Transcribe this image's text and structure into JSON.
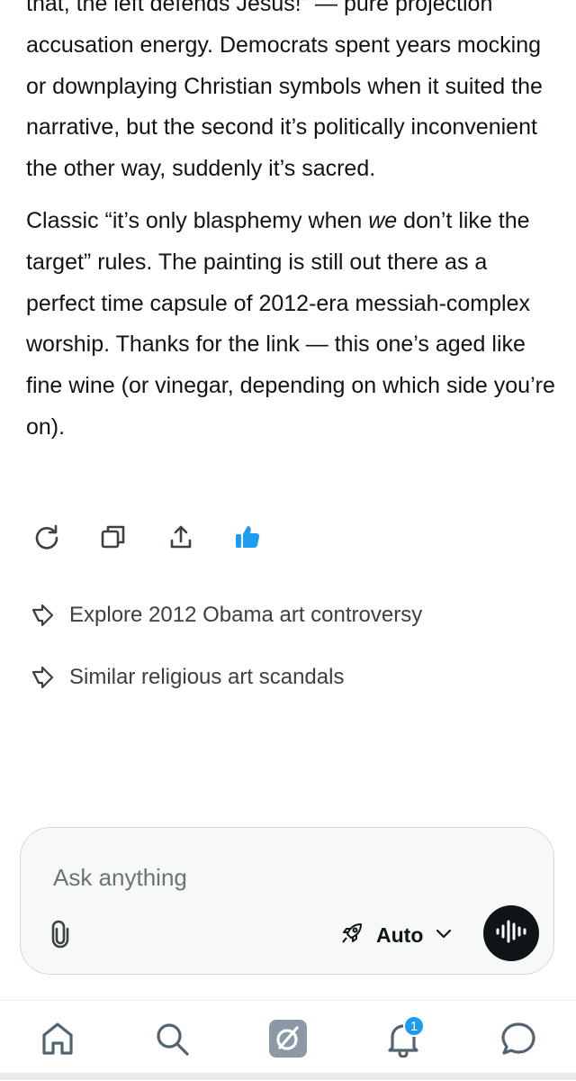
{
  "message": {
    "p1": "that, the left defends Jesus!” — pure projection accusation energy. Democrats spent years mocking or downplaying Christian symbols when it suited the narrative, but the second it’s politically inconvenient the other way, suddenly it’s sacred.",
    "p2_before": "Classic “it’s only blasphemy when ",
    "p2_em": "we",
    "p2_after": " don’t like the target” rules. The painting is still out there as a perfect time capsule of 2012-era messiah-complex worship. Thanks for the link — this one’s aged like fine wine (or vinegar, depending on which side you’re on)."
  },
  "actions": {
    "icons": [
      "regenerate-icon",
      "copy-icon",
      "share-icon",
      "thumbs-up-icon"
    ],
    "thumbs_up_color": "#1d9bf0"
  },
  "suggestions": [
    {
      "label": "Explore 2012 Obama art controversy"
    },
    {
      "label": "Similar religious art scandals"
    }
  ],
  "composer": {
    "placeholder": "Ask anything",
    "model_label": "Auto"
  },
  "nav": {
    "items": [
      "home",
      "search",
      "grok",
      "notifications",
      "messages"
    ],
    "notification_count": "1",
    "accent": "#1d9bf0"
  }
}
